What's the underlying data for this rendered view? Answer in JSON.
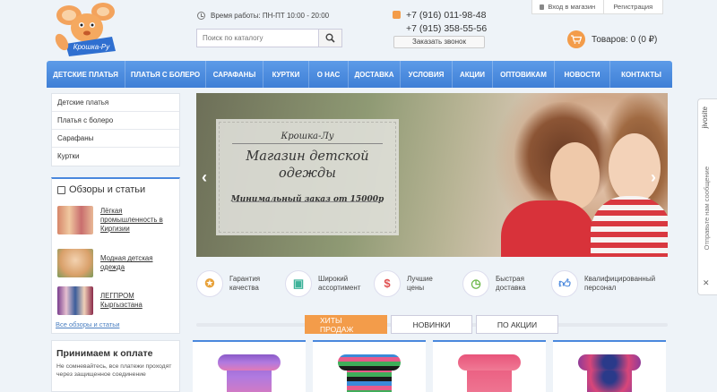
{
  "header": {
    "logo_text": "Крошка-Ру",
    "work_hours": "Время работы: ПН-ПТ 10:00 - 20:00",
    "search_placeholder": "Поиск по каталогу",
    "phones": [
      "+7 (916) 011-98-48",
      "+7 (915) 358-55-56"
    ],
    "callback_label": "Заказать звонок",
    "login_label": "Вход в магазин",
    "register_label": "Регистрация",
    "cart_label": "Товаров: 0 (0 ₽)"
  },
  "nav": {
    "items": [
      "ДЕТСКИЕ ПЛАТЬЯ",
      "ПЛАТЬЯ С БОЛЕРО",
      "САРАФАНЫ",
      "КУРТКИ",
      "О НАС",
      "ДОСТАВКА",
      "УСЛОВИЯ",
      "АКЦИИ",
      "ОПТОВИКАМ",
      "НОВОСТИ",
      "КОНТАКТЫ"
    ]
  },
  "sidebar": {
    "menu": [
      "Детские платья",
      "Платья с болеро",
      "Сарафаны",
      "Куртки"
    ],
    "reviews_title": "Обзоры и статьи",
    "articles": [
      "Лёгкая промышленность в Киргизии",
      "Модная детская одежда",
      "ЛЕГПРОМ Кыргызстана"
    ],
    "all_reviews": "Все обзоры и статьи",
    "payment_title": "Принимаем к оплате",
    "payment_text": "Не сомневайтесь, все платежи проходят через защищенное соединение"
  },
  "banner": {
    "brand": "Крошка-Лу",
    "title": "Магазин детской одежды",
    "min_order": "Минимальный заказ от 15000р"
  },
  "features": [
    {
      "icon": "medal-icon",
      "text": "Гарантия качества",
      "color": "#e8a23a"
    },
    {
      "icon": "box-icon",
      "text": "Широкий ассортимент",
      "color": "#3fb39a"
    },
    {
      "icon": "price-icon",
      "text": "Лучшие цены",
      "color": "#e05050"
    },
    {
      "icon": "timer-icon",
      "text": "Быстрая доставка",
      "color": "#6cb84a"
    },
    {
      "icon": "thumbs-up-icon",
      "text": "Квалифицированный персонал",
      "color": "#4a88dd"
    }
  ],
  "tabs": [
    "ХИТЫ ПРОДАЖ",
    "НОВИНКИ",
    "ПО АКЦИИ"
  ],
  "jivosite": {
    "brand": "jivosite",
    "text": "Отправьте нам сообщение"
  },
  "colors": {
    "accent": "#f39c4a",
    "nav": "#4a88dd"
  }
}
